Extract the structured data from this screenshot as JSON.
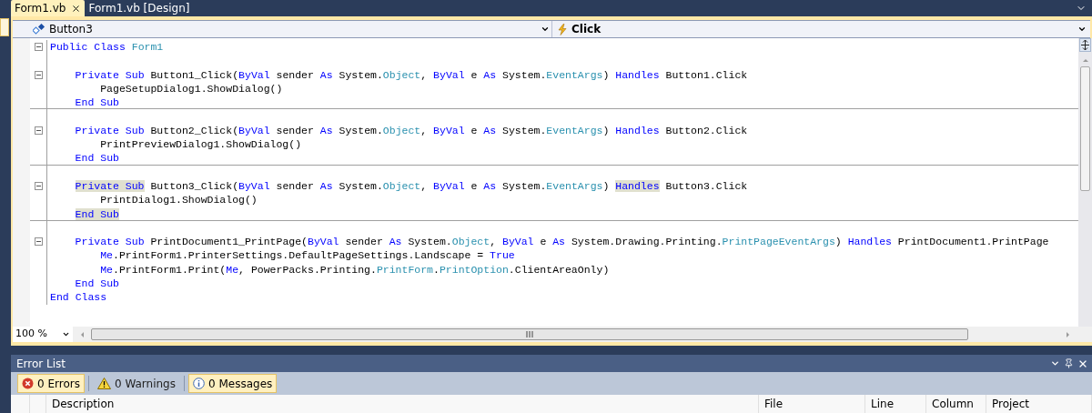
{
  "tabs": [
    {
      "label": "Form1.vb",
      "selected": true
    },
    {
      "label": "Form1.vb [Design]",
      "selected": false
    }
  ],
  "navigation": {
    "object": "Button3",
    "member": "Click"
  },
  "code_lines": [
    {
      "fold": true,
      "separator": false,
      "tokens": [
        {
          "text": "Public",
          "kind": "keyword"
        },
        {
          "text": " Class",
          "kind": "keyword"
        },
        {
          "text": " Form1",
          "kind": "type"
        }
      ]
    },
    {
      "fold": false,
      "separator": false
    },
    {
      "fold": true,
      "separator": false,
      "tokens": [
        {
          "text": "    Private",
          "kind": "keyword"
        },
        {
          "text": " Sub",
          "kind": "keyword"
        },
        {
          "text": " Button1_Click(",
          "kind": "plain"
        },
        {
          "text": "ByVal",
          "kind": "keyword"
        },
        {
          "text": " sender ",
          "kind": "plain"
        },
        {
          "text": "As",
          "kind": "keyword"
        },
        {
          "text": " System.",
          "kind": "plain"
        },
        {
          "text": "Object",
          "kind": "type"
        },
        {
          "text": ", ",
          "kind": "plain"
        },
        {
          "text": "ByVal",
          "kind": "keyword"
        },
        {
          "text": " e ",
          "kind": "plain"
        },
        {
          "text": "As",
          "kind": "keyword"
        },
        {
          "text": " System.",
          "kind": "plain"
        },
        {
          "text": "EventArgs",
          "kind": "type"
        },
        {
          "text": ") ",
          "kind": "plain"
        },
        {
          "text": "Handles",
          "kind": "keyword"
        },
        {
          "text": " Button1.Click",
          "kind": "plain"
        }
      ]
    },
    {
      "fold": false,
      "separator": false,
      "tokens": [
        {
          "text": "        PageSetupDialog1.ShowDialog()",
          "kind": "plain"
        }
      ]
    },
    {
      "fold": false,
      "separator": true,
      "tokens": [
        {
          "text": "    End",
          "kind": "keyword"
        },
        {
          "text": " Sub",
          "kind": "keyword"
        }
      ]
    },
    {
      "fold": false,
      "separator": false
    },
    {
      "fold": true,
      "separator": false,
      "tokens": [
        {
          "text": "    Private",
          "kind": "keyword"
        },
        {
          "text": " Sub",
          "kind": "keyword"
        },
        {
          "text": " Button2_Click(",
          "kind": "plain"
        },
        {
          "text": "ByVal",
          "kind": "keyword"
        },
        {
          "text": " sender ",
          "kind": "plain"
        },
        {
          "text": "As",
          "kind": "keyword"
        },
        {
          "text": " System.",
          "kind": "plain"
        },
        {
          "text": "Object",
          "kind": "type"
        },
        {
          "text": ", ",
          "kind": "plain"
        },
        {
          "text": "ByVal",
          "kind": "keyword"
        },
        {
          "text": " e ",
          "kind": "plain"
        },
        {
          "text": "As",
          "kind": "keyword"
        },
        {
          "text": " System.",
          "kind": "plain"
        },
        {
          "text": "EventArgs",
          "kind": "type"
        },
        {
          "text": ") ",
          "kind": "plain"
        },
        {
          "text": "Handles",
          "kind": "keyword"
        },
        {
          "text": " Button2.Click",
          "kind": "plain"
        }
      ]
    },
    {
      "fold": false,
      "separator": false,
      "tokens": [
        {
          "text": "        PrintPreviewDialog1.ShowDialog()",
          "kind": "plain"
        }
      ]
    },
    {
      "fold": false,
      "separator": true,
      "tokens": [
        {
          "text": "    End",
          "kind": "keyword"
        },
        {
          "text": " Sub",
          "kind": "keyword"
        }
      ]
    },
    {
      "fold": false,
      "separator": false
    },
    {
      "fold": true,
      "separator": false,
      "tokens": [
        {
          "text": "    Private Sub",
          "kind": "match"
        },
        {
          "text": " Button3_Click(",
          "kind": "plain"
        },
        {
          "text": "ByVal",
          "kind": "keyword"
        },
        {
          "text": " sender ",
          "kind": "plain"
        },
        {
          "text": "As",
          "kind": "keyword"
        },
        {
          "text": " System.",
          "kind": "plain"
        },
        {
          "text": "Object",
          "kind": "type"
        },
        {
          "text": ", ",
          "kind": "plain"
        },
        {
          "text": "ByVal",
          "kind": "keyword"
        },
        {
          "text": " e ",
          "kind": "plain"
        },
        {
          "text": "As",
          "kind": "keyword"
        },
        {
          "text": " System.",
          "kind": "plain"
        },
        {
          "text": "EventArgs",
          "kind": "type"
        },
        {
          "text": ") ",
          "kind": "plain"
        },
        {
          "text": "Handles",
          "kind": "match"
        },
        {
          "text": " Button3.Click",
          "kind": "plain"
        }
      ]
    },
    {
      "fold": false,
      "separator": false,
      "tokens": [
        {
          "text": "        PrintDialog1.ShowDialog()",
          "kind": "plain"
        }
      ]
    },
    {
      "fold": false,
      "separator": true,
      "tokens": [
        {
          "text": "    End Sub",
          "kind": "match"
        }
      ]
    },
    {
      "fold": false,
      "separator": false
    },
    {
      "fold": true,
      "separator": false,
      "tokens": [
        {
          "text": "    Private",
          "kind": "keyword"
        },
        {
          "text": " Sub",
          "kind": "keyword"
        },
        {
          "text": " PrintDocument1_PrintPage(",
          "kind": "plain"
        },
        {
          "text": "ByVal",
          "kind": "keyword"
        },
        {
          "text": " sender ",
          "kind": "plain"
        },
        {
          "text": "As",
          "kind": "keyword"
        },
        {
          "text": " System.",
          "kind": "plain"
        },
        {
          "text": "Object",
          "kind": "type"
        },
        {
          "text": ", ",
          "kind": "plain"
        },
        {
          "text": "ByVal",
          "kind": "keyword"
        },
        {
          "text": " e ",
          "kind": "plain"
        },
        {
          "text": "As",
          "kind": "keyword"
        },
        {
          "text": " System.Drawing.Printing.",
          "kind": "plain"
        },
        {
          "text": "PrintPageEventArgs",
          "kind": "type"
        },
        {
          "text": ") ",
          "kind": "plain"
        },
        {
          "text": "Handles",
          "kind": "keyword"
        },
        {
          "text": " PrintDocument1.PrintPage",
          "kind": "plain"
        }
      ]
    },
    {
      "fold": false,
      "separator": false,
      "tokens": [
        {
          "text": "        Me",
          "kind": "keyword"
        },
        {
          "text": ".PrintForm1.PrinterSettings.DefaultPageSettings.Landscape = ",
          "kind": "plain"
        },
        {
          "text": "True",
          "kind": "keyword"
        }
      ]
    },
    {
      "fold": false,
      "separator": false,
      "tokens": [
        {
          "text": "        Me",
          "kind": "keyword"
        },
        {
          "text": ".PrintForm1.Print(",
          "kind": "plain"
        },
        {
          "text": "Me",
          "kind": "keyword"
        },
        {
          "text": ", PowerPacks.Printing.",
          "kind": "plain"
        },
        {
          "text": "PrintForm",
          "kind": "type"
        },
        {
          "text": ".",
          "kind": "plain"
        },
        {
          "text": "PrintOption",
          "kind": "type"
        },
        {
          "text": ".ClientAreaOnly)",
          "kind": "plain"
        }
      ]
    },
    {
      "fold": false,
      "separator": false,
      "tokens": [
        {
          "text": "    End",
          "kind": "keyword"
        },
        {
          "text": " Sub",
          "kind": "keyword"
        }
      ]
    },
    {
      "fold": false,
      "separator": false,
      "tokens": [
        {
          "text": "End",
          "kind": "keyword"
        },
        {
          "text": " Class",
          "kind": "keyword"
        }
      ]
    }
  ],
  "zoom": "100 %",
  "error_list": {
    "title": "Error List",
    "filters": [
      {
        "label": "0 Errors",
        "kind": "error",
        "selected": true
      },
      {
        "label": "0 Warnings",
        "kind": "warning",
        "selected": false
      },
      {
        "label": "0 Messages",
        "kind": "info",
        "selected": true
      }
    ],
    "columns": [
      "Description",
      "File",
      "Line",
      "Column",
      "Project"
    ]
  }
}
